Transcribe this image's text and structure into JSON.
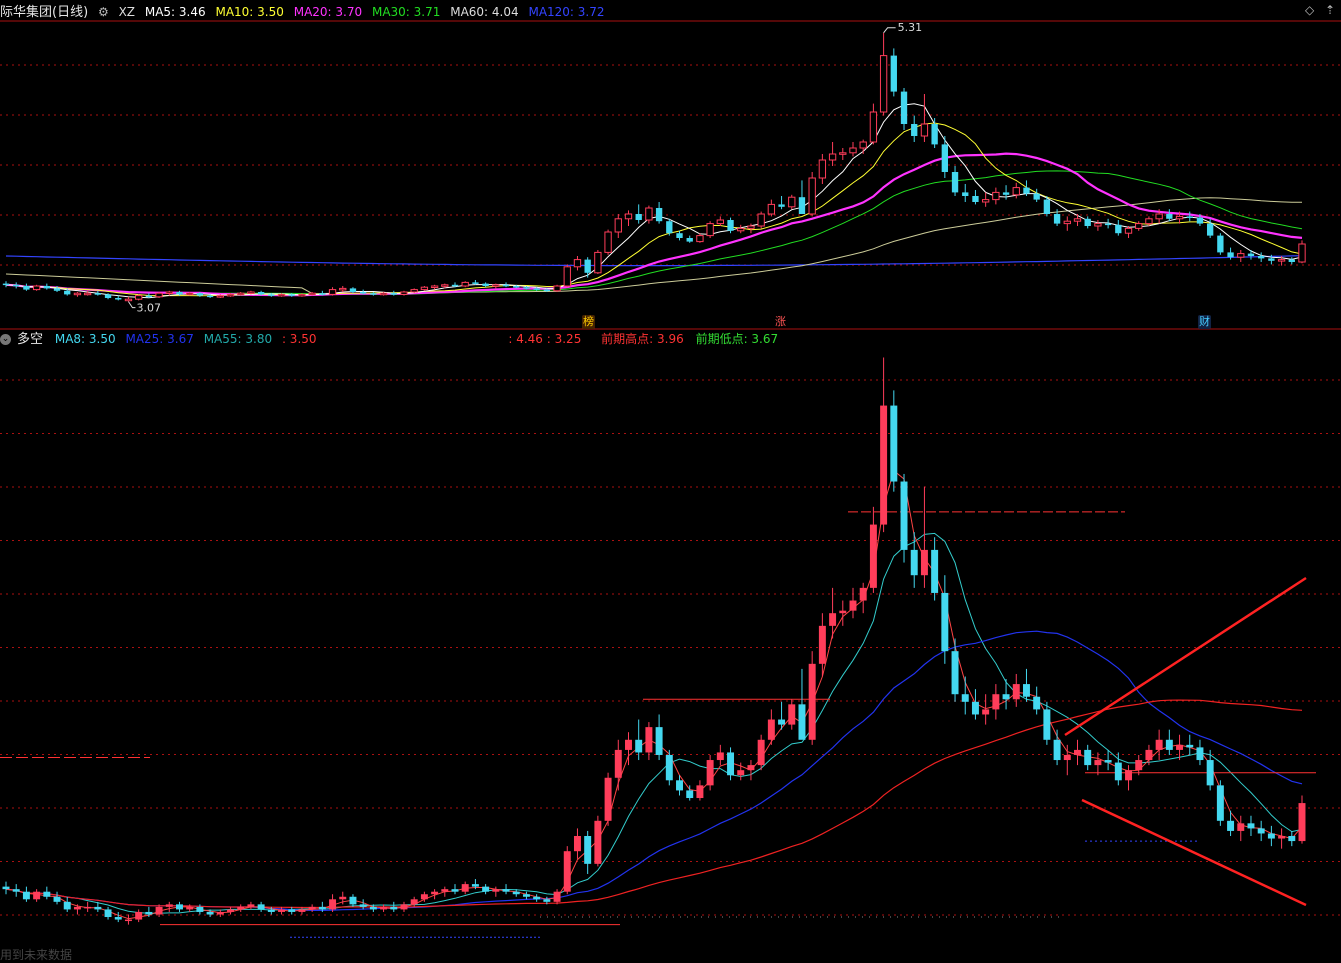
{
  "colors": {
    "up": "#ff3d5a",
    "down": "#44d8f0",
    "ma5": "#ffffff",
    "ma10": "#ffff33",
    "ma20": "#ff33ff",
    "ma30": "#22dd22",
    "ma60": "#cccc99",
    "ma120": "#3344ff",
    "grid": "#aa1111",
    "trendRed": "#ff2222",
    "bg": "#000000"
  },
  "top_header": {
    "title": "际华集团(日线)",
    "indicator": "XZ",
    "ma5": "MA5: 3.46",
    "ma10": "MA10: 3.50",
    "ma20": "MA20: 3.70",
    "ma30": "MA30: 3.71",
    "ma60": "MA60: 4.04",
    "ma120": "MA120: 3.72",
    "max_label": "5.31",
    "min_label": "3.07",
    "marker_labels": [
      "榜",
      "涨",
      "财"
    ]
  },
  "bottom_header": {
    "title": "多空",
    "ma8": "MA8: 3.50",
    "ma25": "MA25: 3.67",
    "ma55": "MA55: 3.80",
    "val": ": 3.50",
    "range": ": 4.46  : 3.25",
    "prev_high": "前期高点: 3.96",
    "prev_low": "前期低点: 3.67"
  },
  "watermark": "用到未来数据",
  "chart_data": [
    {
      "type": "candlestick",
      "title": "际华集团(日线)",
      "price_range": [
        3.07,
        5.31
      ],
      "candles_ohlc": [
        [
          3.22,
          3.24,
          3.19,
          3.21
        ],
        [
          3.21,
          3.23,
          3.18,
          3.2
        ],
        [
          3.2,
          3.22,
          3.16,
          3.17
        ],
        [
          3.17,
          3.21,
          3.16,
          3.2
        ],
        [
          3.2,
          3.22,
          3.17,
          3.18
        ],
        [
          3.18,
          3.2,
          3.15,
          3.16
        ],
        [
          3.16,
          3.18,
          3.12,
          3.13
        ],
        [
          3.13,
          3.15,
          3.11,
          3.14
        ],
        [
          3.14,
          3.16,
          3.12,
          3.14
        ],
        [
          3.14,
          3.16,
          3.12,
          3.13
        ],
        [
          3.13,
          3.14,
          3.09,
          3.1
        ],
        [
          3.1,
          3.12,
          3.08,
          3.09
        ],
        [
          3.09,
          3.11,
          3.07,
          3.09
        ],
        [
          3.09,
          3.13,
          3.08,
          3.12
        ],
        [
          3.12,
          3.14,
          3.1,
          3.11
        ],
        [
          3.11,
          3.15,
          3.1,
          3.14
        ],
        [
          3.14,
          3.16,
          3.12,
          3.15
        ],
        [
          3.15,
          3.16,
          3.12,
          3.13
        ],
        [
          3.13,
          3.15,
          3.12,
          3.14
        ],
        [
          3.14,
          3.15,
          3.11,
          3.12
        ],
        [
          3.12,
          3.13,
          3.1,
          3.11
        ],
        [
          3.11,
          3.13,
          3.1,
          3.12
        ],
        [
          3.12,
          3.14,
          3.11,
          3.13
        ],
        [
          3.13,
          3.15,
          3.12,
          3.14
        ],
        [
          3.14,
          3.16,
          3.13,
          3.15
        ],
        [
          3.15,
          3.16,
          3.12,
          3.13
        ],
        [
          3.13,
          3.14,
          3.11,
          3.12
        ],
        [
          3.12,
          3.14,
          3.11,
          3.13
        ],
        [
          3.13,
          3.14,
          3.11,
          3.12
        ],
        [
          3.12,
          3.14,
          3.11,
          3.13
        ],
        [
          3.13,
          3.15,
          3.12,
          3.14
        ],
        [
          3.14,
          3.16,
          3.12,
          3.13
        ],
        [
          3.13,
          3.19,
          3.12,
          3.17
        ],
        [
          3.17,
          3.2,
          3.15,
          3.18
        ],
        [
          3.18,
          3.19,
          3.14,
          3.15
        ],
        [
          3.15,
          3.17,
          3.13,
          3.14
        ],
        [
          3.14,
          3.15,
          3.12,
          3.13
        ],
        [
          3.13,
          3.15,
          3.12,
          3.14
        ],
        [
          3.14,
          3.16,
          3.12,
          3.13
        ],
        [
          3.13,
          3.16,
          3.12,
          3.15
        ],
        [
          3.15,
          3.18,
          3.14,
          3.17
        ],
        [
          3.17,
          3.2,
          3.16,
          3.19
        ],
        [
          3.19,
          3.21,
          3.17,
          3.2
        ],
        [
          3.2,
          3.22,
          3.18,
          3.21
        ],
        [
          3.21,
          3.23,
          3.19,
          3.2
        ],
        [
          3.2,
          3.24,
          3.19,
          3.23
        ],
        [
          3.23,
          3.25,
          3.21,
          3.22
        ],
        [
          3.22,
          3.23,
          3.19,
          3.2
        ],
        [
          3.2,
          3.22,
          3.18,
          3.21
        ],
        [
          3.21,
          3.23,
          3.19,
          3.2
        ],
        [
          3.2,
          3.21,
          3.18,
          3.19
        ],
        [
          3.19,
          3.2,
          3.17,
          3.18
        ],
        [
          3.18,
          3.19,
          3.16,
          3.17
        ],
        [
          3.17,
          3.18,
          3.15,
          3.16
        ],
        [
          3.16,
          3.21,
          3.15,
          3.2
        ],
        [
          3.2,
          3.38,
          3.19,
          3.36
        ],
        [
          3.36,
          3.45,
          3.33,
          3.42
        ],
        [
          3.42,
          3.44,
          3.27,
          3.31
        ],
        [
          3.31,
          3.5,
          3.3,
          3.48
        ],
        [
          3.48,
          3.67,
          3.46,
          3.65
        ],
        [
          3.65,
          3.8,
          3.6,
          3.76
        ],
        [
          3.76,
          3.83,
          3.7,
          3.8
        ],
        [
          3.8,
          3.88,
          3.72,
          3.75
        ],
        [
          3.75,
          3.87,
          3.72,
          3.85
        ],
        [
          3.85,
          3.9,
          3.72,
          3.74
        ],
        [
          3.74,
          3.76,
          3.62,
          3.64
        ],
        [
          3.64,
          3.66,
          3.58,
          3.6
        ],
        [
          3.6,
          3.62,
          3.56,
          3.57
        ],
        [
          3.57,
          3.64,
          3.56,
          3.62
        ],
        [
          3.62,
          3.74,
          3.6,
          3.72
        ],
        [
          3.72,
          3.78,
          3.7,
          3.75
        ],
        [
          3.75,
          3.77,
          3.64,
          3.66
        ],
        [
          3.66,
          3.71,
          3.64,
          3.68
        ],
        [
          3.68,
          3.72,
          3.64,
          3.7
        ],
        [
          3.7,
          3.82,
          3.68,
          3.8
        ],
        [
          3.8,
          3.92,
          3.78,
          3.88
        ],
        [
          3.88,
          3.95,
          3.84,
          3.86
        ],
        [
          3.86,
          3.96,
          3.84,
          3.94
        ],
        [
          3.94,
          4.08,
          3.9,
          3.8
        ],
        [
          3.8,
          4.15,
          3.78,
          4.1
        ],
        [
          4.1,
          4.3,
          4.05,
          4.25
        ],
        [
          4.25,
          4.4,
          4.2,
          4.3
        ],
        [
          4.3,
          4.35,
          4.25,
          4.31
        ],
        [
          4.31,
          4.4,
          4.28,
          4.35
        ],
        [
          4.35,
          4.42,
          4.3,
          4.4
        ],
        [
          4.4,
          4.72,
          4.38,
          4.65
        ],
        [
          4.65,
          5.31,
          4.62,
          5.12
        ],
        [
          5.12,
          5.18,
          4.78,
          4.82
        ],
        [
          4.82,
          4.85,
          4.5,
          4.55
        ],
        [
          4.55,
          4.62,
          4.4,
          4.45
        ],
        [
          4.45,
          4.8,
          4.4,
          4.55
        ],
        [
          4.55,
          4.6,
          4.35,
          4.38
        ],
        [
          4.38,
          4.45,
          4.1,
          4.15
        ],
        [
          4.15,
          4.2,
          3.95,
          3.98
        ],
        [
          3.98,
          4.05,
          3.9,
          3.95
        ],
        [
          3.95,
          4.0,
          3.88,
          3.9
        ],
        [
          3.9,
          3.98,
          3.86,
          3.92
        ],
        [
          3.92,
          4.02,
          3.88,
          3.98
        ],
        [
          3.98,
          4.04,
          3.92,
          3.96
        ],
        [
          3.96,
          4.06,
          3.93,
          4.02
        ],
        [
          4.02,
          4.08,
          3.95,
          3.97
        ],
        [
          3.97,
          4.01,
          3.9,
          3.92
        ],
        [
          3.92,
          3.95,
          3.78,
          3.8
        ],
        [
          3.8,
          3.84,
          3.7,
          3.72
        ],
        [
          3.72,
          3.78,
          3.66,
          3.74
        ],
        [
          3.74,
          3.8,
          3.7,
          3.76
        ],
        [
          3.76,
          3.78,
          3.68,
          3.7
        ],
        [
          3.7,
          3.75,
          3.66,
          3.72
        ],
        [
          3.72,
          3.76,
          3.68,
          3.71
        ],
        [
          3.71,
          3.75,
          3.62,
          3.64
        ],
        [
          3.64,
          3.7,
          3.6,
          3.68
        ],
        [
          3.68,
          3.74,
          3.66,
          3.72
        ],
        [
          3.72,
          3.78,
          3.7,
          3.76
        ],
        [
          3.76,
          3.84,
          3.72,
          3.8
        ],
        [
          3.8,
          3.84,
          3.74,
          3.76
        ],
        [
          3.76,
          3.82,
          3.72,
          3.78
        ],
        [
          3.78,
          3.82,
          3.74,
          3.77
        ],
        [
          3.77,
          3.8,
          3.7,
          3.72
        ],
        [
          3.72,
          3.76,
          3.6,
          3.62
        ],
        [
          3.62,
          3.64,
          3.46,
          3.48
        ],
        [
          3.48,
          3.52,
          3.42,
          3.44
        ],
        [
          3.44,
          3.5,
          3.4,
          3.47
        ],
        [
          3.47,
          3.5,
          3.42,
          3.45
        ],
        [
          3.45,
          3.48,
          3.4,
          3.43
        ],
        [
          3.43,
          3.46,
          3.38,
          3.41
        ],
        [
          3.41,
          3.45,
          3.37,
          3.42
        ],
        [
          3.42,
          3.44,
          3.38,
          3.4
        ],
        [
          3.4,
          3.58,
          3.39,
          3.55
        ]
      ]
    },
    {
      "type": "line",
      "title": "多空",
      "series": [
        {
          "name": "MA8"
        },
        {
          "name": "MA25"
        },
        {
          "name": "MA55"
        }
      ],
      "reference_levels": [
        3.96,
        3.67
      ]
    }
  ]
}
